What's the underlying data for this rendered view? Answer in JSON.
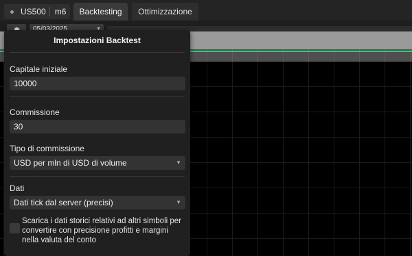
{
  "topbar": {
    "symbol": "US500",
    "timeframe": "m6",
    "tabs": [
      {
        "label": "Backtesting",
        "active": true
      },
      {
        "label": "Ottimizzazione",
        "active": false
      }
    ]
  },
  "toolbar": {
    "settings_icon": "gear-icon",
    "date_value": "05/03/2025"
  },
  "panel": {
    "title": "Impostazioni Backtest",
    "initial_capital": {
      "label": "Capitale iniziale",
      "value": "10000"
    },
    "commission": {
      "label": "Commissione",
      "value": "30"
    },
    "commission_type": {
      "label": "Tipo di commissione",
      "value": "USD per mln di USD di volume"
    },
    "data": {
      "label": "Dati",
      "value": "Dati tick dal server (precisi)"
    },
    "download_checkbox": {
      "label": "Scarica i dati storici relativi ad altri simboli per convertire con precisione profitti e margini nella valuta del conto",
      "checked": false
    }
  },
  "colors": {
    "equity_line": "#2ecc71",
    "panel_bg": "#202020",
    "chart_bg": "#000000"
  }
}
